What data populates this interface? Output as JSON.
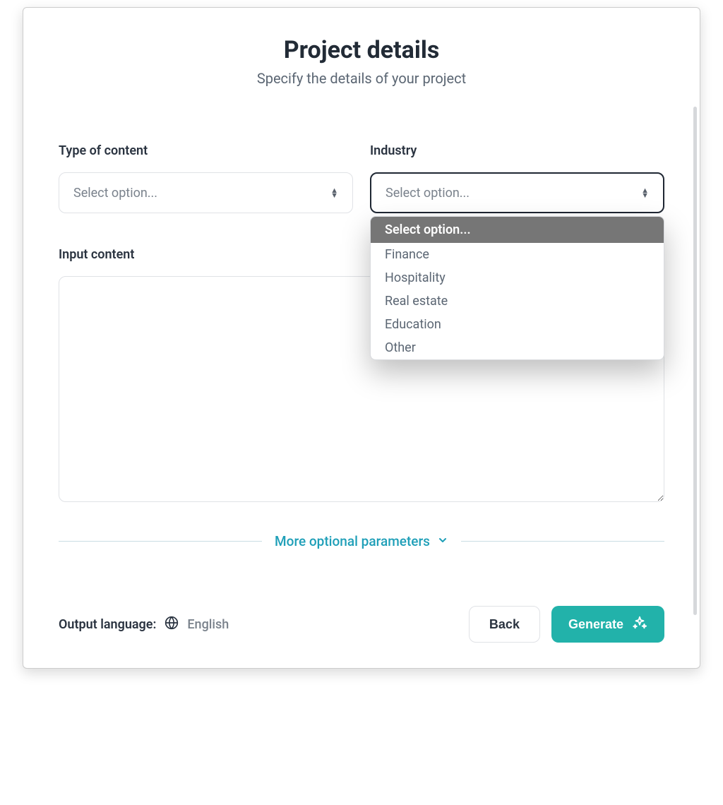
{
  "header": {
    "title": "Project details",
    "subtitle": "Specify the details of your project"
  },
  "fields": {
    "content_type": {
      "label": "Type of content",
      "placeholder": "Select option..."
    },
    "industry": {
      "label": "Industry",
      "placeholder": "Select option...",
      "options": [
        "Select option...",
        "Finance",
        "Hospitality",
        "Real estate",
        "Education",
        "Other"
      ],
      "selected_index": 0
    },
    "input_content": {
      "label": "Input content",
      "value": ""
    }
  },
  "more_params_label": "More optional parameters",
  "footer": {
    "output_language_label": "Output language:",
    "output_language_value": "English",
    "back_button": "Back",
    "generate_button": "Generate"
  }
}
